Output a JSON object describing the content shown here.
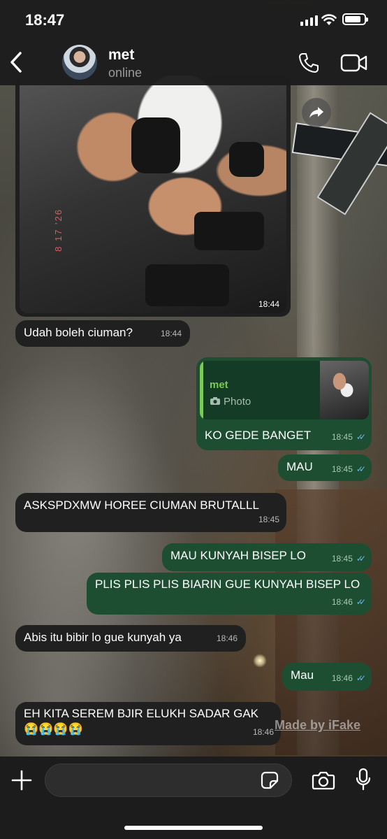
{
  "status_bar": {
    "time": "18:47"
  },
  "header": {
    "contact_name": "met",
    "contact_status": "online"
  },
  "image_message": {
    "date_stamp": "8 17 '26",
    "time": "18:44"
  },
  "messages": [
    {
      "direction": "in",
      "text": "Udah boleh ciuman?",
      "time": "18:44"
    },
    {
      "direction": "out",
      "reply_to": {
        "name": "met",
        "type": "Photo"
      },
      "text": "KO GEDE BANGET",
      "time": "18:45"
    },
    {
      "direction": "out",
      "text": "MAU",
      "time": "18:45"
    },
    {
      "direction": "in",
      "text": "ASKSPDXMW HOREE CIUMAN BRUTALLL",
      "time": "18:45"
    },
    {
      "direction": "out",
      "text": "MAU KUNYAH BISEP LO",
      "time": "18:45"
    },
    {
      "direction": "out",
      "text": "PLIS PLIS PLIS BIARIN GUE KUNYAH BISEP LO",
      "time": "18:46"
    },
    {
      "direction": "in",
      "text": "Abis itu bibir lo gue kunyah ya",
      "time": "18:46"
    },
    {
      "direction": "out",
      "text": "Mau",
      "time": "18:46"
    },
    {
      "direction": "in",
      "text": "EH KITA SEREM BJIR ELUKH SADAR GAK",
      "emoji": "😭😭😭😭",
      "time": "18:46"
    }
  ],
  "watermark": "Made by iFake",
  "input": {
    "value": ""
  },
  "colors": {
    "outgoing_bubble": "#1d4e32",
    "incoming_bubble": "#202020",
    "read_tick": "#6fb7e8",
    "reply_accent": "#7cc95a"
  },
  "icons": [
    "back-icon",
    "phone-icon",
    "video-icon",
    "forward-icon",
    "plus-icon",
    "sticker-icon",
    "camera-icon",
    "mic-icon"
  ]
}
